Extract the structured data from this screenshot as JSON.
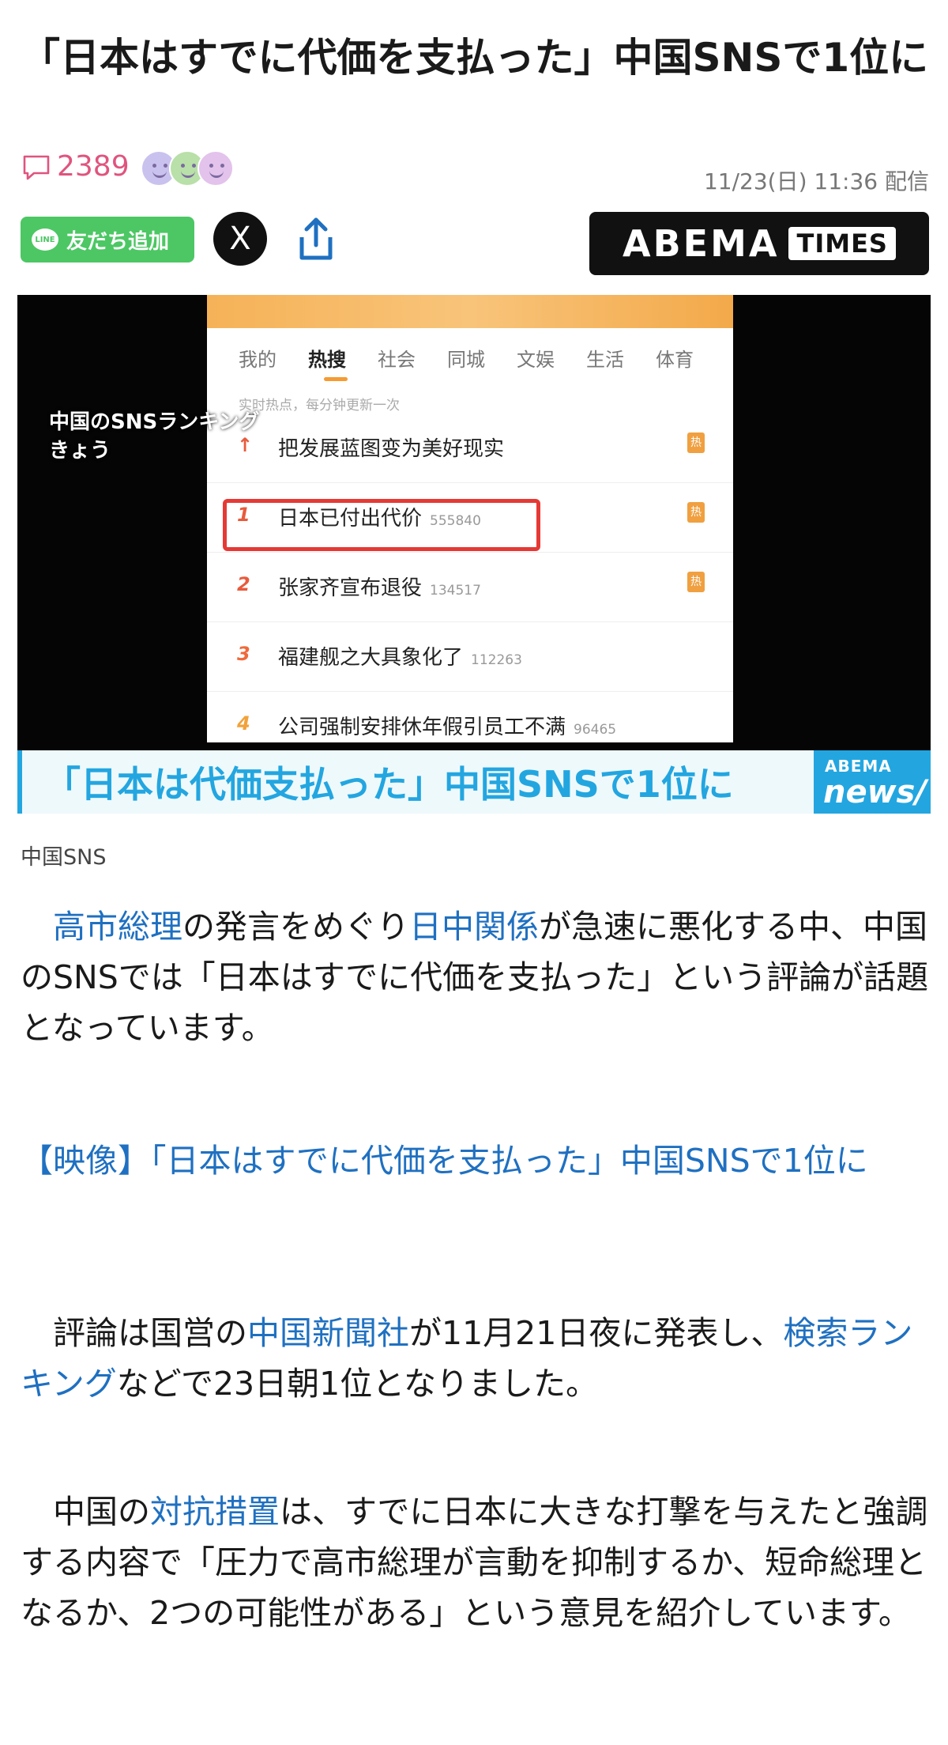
{
  "article": {
    "title": "「日本はすでに代価を支払った」中国SNSで1位に",
    "comment_count": "2389",
    "date": "11/23(日) 11:36 配信",
    "line_button_label": "友だち追加",
    "line_logo_text": "LINE",
    "x_button_label": "X",
    "publisher_logo": "ABEMA",
    "publisher_logo_sub": "TIMES"
  },
  "media": {
    "caption_overlay": "中国のSNSランキング\nきょう",
    "tabs": [
      "我的",
      "热搜",
      "社会",
      "同城",
      "文娱",
      "生活",
      "体育"
    ],
    "subhead": "实时热点，每分钟更新一次",
    "ranking": [
      {
        "num": "↑",
        "text": "把发展蓝图变为美好现实",
        "count": "",
        "badge": "热"
      },
      {
        "num": "1",
        "text": "日本已付出代价",
        "count": "555840",
        "badge": "热"
      },
      {
        "num": "2",
        "text": "张家齐宣布退役",
        "count": "134517",
        "badge": "热"
      },
      {
        "num": "3",
        "text": "福建舰之大具象化了",
        "count": "112263",
        "badge": ""
      },
      {
        "num": "4",
        "text": "公司强制安排休年假引员工不满",
        "count": "96465",
        "badge": ""
      }
    ],
    "banner_text": "「日本は代価支払った」中国SNSで1位に",
    "banner_logo_top": "ABEMA",
    "banner_logo_bottom": "news/",
    "image_caption": "中国SNS"
  },
  "body": {
    "p1_link1": "高市総理",
    "p1_text1": "の発言をめぐり",
    "p1_link2": "日中関係",
    "p1_text2": "が急速に悪化する中、中国のSNSでは「日本はすでに代価を支払った」という評論が話題となっています。",
    "video_link": "【映像】「日本はすでに代価を支払った」中国SNSで1位に",
    "p2_text1": "評論は国営の",
    "p2_link1": "中国新聞社",
    "p2_text2": "が11月21日夜に発表し、",
    "p2_link2": "検索ランキング",
    "p2_text3": "などで23日朝1位となりました。",
    "p3_text1": "中国の",
    "p3_link1": "対抗措置",
    "p3_text2": "は、すでに日本に大きな打撃を与えたと強調する内容で「圧力で高市総理が言動を抑制するか、短命総理となるか、2つの可能性がある」という意見を紹介しています。"
  },
  "colors": {
    "accent_link": "#1f70c1",
    "comment_pink": "#e0547e",
    "line_green": "#4cc764",
    "abema_blue": "#23a6e0",
    "highlight_red": "#e53935"
  },
  "icons": [
    "comment-icon",
    "reaction-faces",
    "line-logo-icon",
    "x-logo-icon",
    "share-icon"
  ]
}
